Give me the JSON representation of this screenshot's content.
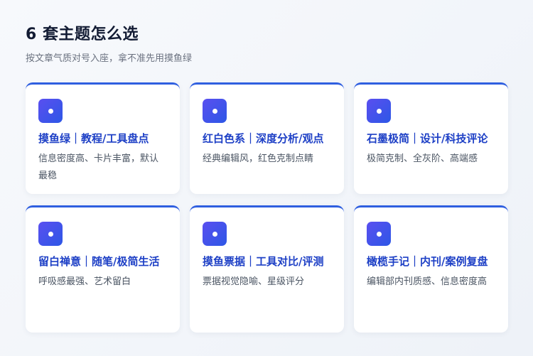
{
  "header": {
    "title": "6 套主题怎么选",
    "subtitle": "按文章气质对号入座，拿不准先用摸鱼绿"
  },
  "colors": {
    "accent": "#2f5fe0",
    "title": "#1e40c6",
    "icon_gradient_start": "#5a4ff0",
    "icon_gradient_end": "#2d57e6"
  },
  "themes": [
    {
      "title": "摸鱼绿｜教程/工具盘点",
      "desc": "信息密度高、卡片丰富，默认最稳",
      "icon": "theme-icon"
    },
    {
      "title": "红白色系｜深度分析/观点",
      "desc": "经典编辑风，红色克制点睛",
      "icon": "theme-icon"
    },
    {
      "title": "石墨极简｜设计/科技评论",
      "desc": "极简克制、全灰阶、高端感",
      "icon": "theme-icon"
    },
    {
      "title": "留白禅意｜随笔/极简生活",
      "desc": "呼吸感最强、艺术留白",
      "icon": "theme-icon"
    },
    {
      "title": "摸鱼票据｜工具对比/评测",
      "desc": "票据视觉隐喻、星级评分",
      "icon": "theme-icon"
    },
    {
      "title": "橄榄手记｜内刊/案例复盘",
      "desc": "编辑部内刊质感、信息密度高",
      "icon": "theme-icon"
    }
  ]
}
